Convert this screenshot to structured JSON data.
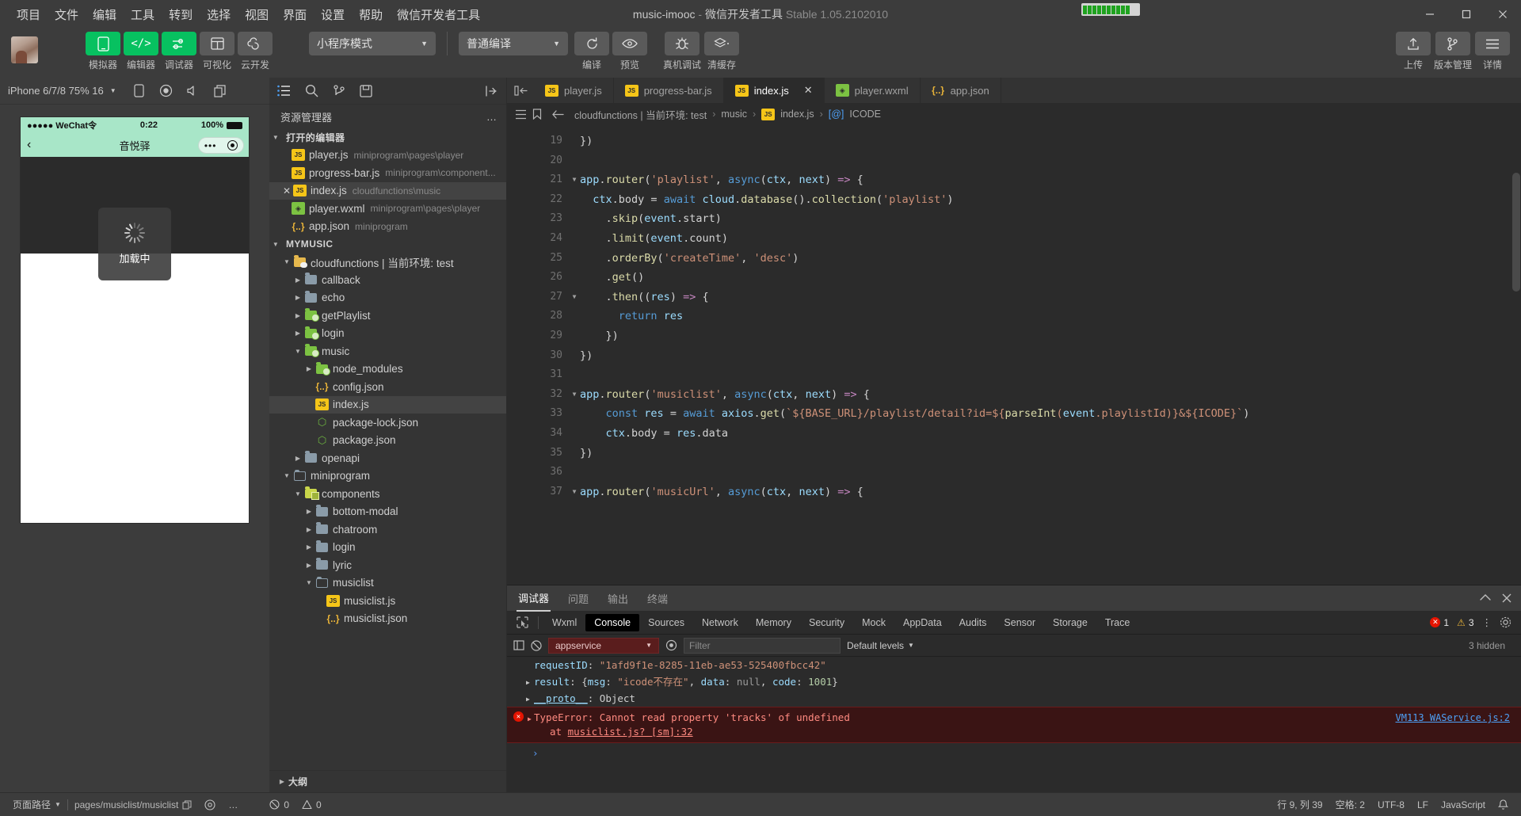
{
  "window": {
    "menu": [
      "项目",
      "文件",
      "编辑",
      "工具",
      "转到",
      "选择",
      "视图",
      "界面",
      "设置",
      "帮助",
      "微信开发者工具"
    ],
    "title_project": "music-imooc",
    "title_dash": " - ",
    "title_app": "微信开发者工具",
    "title_version": "Stable 1.05.2102010",
    "minimize": "—",
    "maximize": "▢",
    "close": "✕"
  },
  "toolbar": {
    "buttons": [
      {
        "label": "模拟器",
        "icon": "phone-icon",
        "style": "green"
      },
      {
        "label": "编辑器",
        "icon": "code-icon",
        "style": "green"
      },
      {
        "label": "调试器",
        "icon": "debug-toggle-icon",
        "style": "green"
      },
      {
        "label": "可视化",
        "icon": "layout-icon",
        "style": "grey"
      },
      {
        "label": "云开发",
        "icon": "cloud-icon",
        "style": "grey"
      }
    ],
    "mode_select": "小程序模式",
    "compile_select": "普通编译",
    "actions": [
      {
        "label": "编译",
        "icon": "refresh-icon"
      },
      {
        "label": "预览",
        "icon": "eye-icon"
      },
      {
        "label": "真机调试",
        "icon": "bug-icon"
      },
      {
        "label": "清缓存",
        "icon": "layers-icon"
      }
    ],
    "right_actions": [
      {
        "label": "上传",
        "icon": "upload-icon"
      },
      {
        "label": "版本管理",
        "icon": "git-branch-icon"
      },
      {
        "label": "详情",
        "icon": "menu-lines-icon"
      }
    ]
  },
  "simulator": {
    "device": "iPhone 6/7/8 75% 16",
    "icons": [
      "phone-rotate-icon",
      "record-icon",
      "volume-icon",
      "copy-icon"
    ],
    "phone": {
      "carrier": "●●●●● WeChat令",
      "time": "0:22",
      "battery_pct": "100%",
      "nav_title": "音悦驿",
      "back": "‹",
      "capsule_dots": "•••",
      "toast_text": "加载中"
    }
  },
  "explorer": {
    "icons": [
      "explorer-icon",
      "search-icon",
      "source-control-icon",
      "save-all-icon",
      "collapse-icon"
    ],
    "title": "资源管理器",
    "more": "…",
    "open_editors": {
      "label": "打开的编辑器",
      "items": [
        {
          "name": "player.js",
          "path": "miniprogram\\pages\\player",
          "icon": "js-file-icon",
          "indent": 2,
          "closable": false,
          "selected": false
        },
        {
          "name": "progress-bar.js",
          "path": "miniprogram\\component...",
          "icon": "js-file-icon",
          "indent": 2,
          "closable": false,
          "selected": false
        },
        {
          "name": "index.js",
          "path": "cloudfunctions\\music",
          "icon": "js-file-icon",
          "indent": 2,
          "closable": true,
          "selected": true
        },
        {
          "name": "player.wxml",
          "path": "miniprogram\\pages\\player",
          "icon": "wxml-file-icon",
          "indent": 2,
          "closable": false,
          "selected": false
        },
        {
          "name": "app.json",
          "path": "miniprogram",
          "icon": "json-file-icon",
          "indent": 2,
          "closable": false,
          "selected": false
        }
      ]
    },
    "project": {
      "label": "MYMUSIC",
      "items": [
        {
          "name": "cloudfunctions | 当前环境: test",
          "icon": "cloud-folder-icon",
          "indent": 1,
          "arrow": "down",
          "selected": false
        },
        {
          "name": "callback",
          "icon": "folder-icon",
          "indent": 2,
          "arrow": "right",
          "selected": false
        },
        {
          "name": "echo",
          "icon": "folder-icon",
          "indent": 2,
          "arrow": "right",
          "selected": false
        },
        {
          "name": "getPlaylist",
          "icon": "node-folder-icon",
          "indent": 2,
          "arrow": "right",
          "selected": false
        },
        {
          "name": "login",
          "icon": "node-folder-icon",
          "indent": 2,
          "arrow": "right",
          "selected": false
        },
        {
          "name": "music",
          "icon": "node-folder-icon",
          "indent": 2,
          "arrow": "down",
          "selected": false
        },
        {
          "name": "node_modules",
          "icon": "node-folder-icon",
          "indent": 3,
          "arrow": "right",
          "selected": false
        },
        {
          "name": "config.json",
          "icon": "json-file-icon",
          "indent": 3,
          "arrow": "none",
          "selected": false
        },
        {
          "name": "index.js",
          "icon": "js-file-icon",
          "indent": 3,
          "arrow": "none",
          "selected": true
        },
        {
          "name": "package-lock.json",
          "icon": "node-file-icon",
          "indent": 3,
          "arrow": "none",
          "selected": false
        },
        {
          "name": "package.json",
          "icon": "node-file-icon",
          "indent": 3,
          "arrow": "none",
          "selected": false
        },
        {
          "name": "openapi",
          "icon": "folder-icon",
          "indent": 2,
          "arrow": "right",
          "selected": false
        },
        {
          "name": "miniprogram",
          "icon": "folder-open-icon",
          "indent": 1,
          "arrow": "down",
          "selected": false
        },
        {
          "name": "components",
          "icon": "component-folder-icon",
          "indent": 2,
          "arrow": "down",
          "selected": false
        },
        {
          "name": "bottom-modal",
          "icon": "folder-icon",
          "indent": 3,
          "arrow": "right",
          "selected": false
        },
        {
          "name": "chatroom",
          "icon": "folder-icon",
          "indent": 3,
          "arrow": "right",
          "selected": false
        },
        {
          "name": "login",
          "icon": "folder-icon",
          "indent": 3,
          "arrow": "right",
          "selected": false
        },
        {
          "name": "lyric",
          "icon": "folder-icon",
          "indent": 3,
          "arrow": "right",
          "selected": false
        },
        {
          "name": "musiclist",
          "icon": "folder-open-icon",
          "indent": 3,
          "arrow": "down",
          "selected": false
        },
        {
          "name": "musiclist.js",
          "icon": "js-file-icon",
          "indent": 4,
          "arrow": "none",
          "selected": false
        },
        {
          "name": "musiclist.json",
          "icon": "json-file-icon",
          "indent": 4,
          "arrow": "none",
          "selected": false
        }
      ]
    },
    "outline": "大纲"
  },
  "editor": {
    "tabs": [
      {
        "label": "player.js",
        "icon": "js-file-icon",
        "active": false,
        "closable": false
      },
      {
        "label": "progress-bar.js",
        "icon": "js-file-icon",
        "active": false,
        "closable": false
      },
      {
        "label": "index.js",
        "icon": "js-file-icon",
        "active": true,
        "closable": true
      },
      {
        "label": "player.wxml",
        "icon": "wxml-file-icon",
        "active": false,
        "closable": false
      },
      {
        "label": "app.json",
        "icon": "json-file-icon",
        "active": false,
        "closable": false
      }
    ],
    "tab_close": "✕",
    "breadcrumb": [
      "cloudfunctions | 当前环境: test",
      "music",
      "index.js",
      "ICODE"
    ],
    "breadcrumb_sep": "›",
    "first_line": 19,
    "lines": [
      {
        "n": 19,
        "fold": "",
        "text": "})"
      },
      {
        "n": 20,
        "fold": "",
        "text": ""
      },
      {
        "n": 21,
        "fold": "down",
        "text": "app.router('playlist', async(ctx, next) => {"
      },
      {
        "n": 22,
        "fold": "",
        "text": "  ctx.body = await cloud.database().collection('playlist')"
      },
      {
        "n": 23,
        "fold": "",
        "text": "    .skip(event.start)"
      },
      {
        "n": 24,
        "fold": "",
        "text": "    .limit(event.count)"
      },
      {
        "n": 25,
        "fold": "",
        "text": "    .orderBy('createTime', 'desc')"
      },
      {
        "n": 26,
        "fold": "",
        "text": "    .get()"
      },
      {
        "n": 27,
        "fold": "down",
        "text": "    .then((res) => {"
      },
      {
        "n": 28,
        "fold": "",
        "text": "      return res"
      },
      {
        "n": 29,
        "fold": "",
        "text": "    })"
      },
      {
        "n": 30,
        "fold": "",
        "text": "})"
      },
      {
        "n": 31,
        "fold": "",
        "text": ""
      },
      {
        "n": 32,
        "fold": "down",
        "text": "app.router('musiclist', async(ctx, next) => {"
      },
      {
        "n": 33,
        "fold": "",
        "text": "    const res = await axios.get(`${BASE_URL}/playlist/detail?id=${parseInt(event.playlistId)}&${ICODE}`)"
      },
      {
        "n": 34,
        "fold": "",
        "text": "    ctx.body = res.data"
      },
      {
        "n": 35,
        "fold": "",
        "text": "})"
      },
      {
        "n": 36,
        "fold": "",
        "text": ""
      },
      {
        "n": 37,
        "fold": "down",
        "text": "app.router('musicUrl', async(ctx, next) => {"
      }
    ]
  },
  "debugger": {
    "panel_tabs": [
      "调试器",
      "问题",
      "输出",
      "终端"
    ],
    "panel_active": "调试器",
    "panel_actions": [
      "chevron-up-icon",
      "close-icon"
    ],
    "devtools_tabs": [
      "Wxml",
      "Console",
      "Sources",
      "Network",
      "Memory",
      "Security",
      "Mock",
      "AppData",
      "Audits",
      "Sensor",
      "Storage",
      "Trace"
    ],
    "devtools_active": "Console",
    "inspect_icon": "inspect-icon",
    "error_count": "1",
    "warning_count": "3",
    "more_icon": "⋮",
    "settings_icon": "gear-icon",
    "console": {
      "context": "appservice",
      "filter_placeholder": "Filter",
      "levels": "Default levels",
      "hidden": "3 hidden",
      "clear_icon": "clear-icon",
      "eye_icon": "eye-icon",
      "sidebar_icon": "sidebar-icon",
      "lines": [
        {
          "type": "kv",
          "key": "requestID",
          "value": "\"1afd9f1e-8285-11eb-ae53-525400fbcc42\""
        },
        {
          "type": "obj",
          "key": "result",
          "value": "{msg: \"icode不存在\", data: null, code: 1001}"
        },
        {
          "type": "obj",
          "key": "__proto__",
          "value": "Object"
        }
      ],
      "error": {
        "message": "TypeError: Cannot read property 'tracks' of undefined",
        "at": "at ",
        "source": "musiclist.js? [sm]:32",
        "right_source": "VM113 WAService.js:2"
      },
      "prompt": "›"
    }
  },
  "statusbar": {
    "page_path_label": "页面路径",
    "page_path": "pages/musiclist/musiclist",
    "copy_icon": "copy-icon",
    "eye_icon": "eye-icon",
    "more_icon": "…",
    "errors": "0",
    "warnings": "0",
    "cursor": "行 9, 列 39",
    "spaces": "空格: 2",
    "encoding": "UTF-8",
    "eol": "LF",
    "language": "JavaScript",
    "bell_icon": "bell-icon"
  },
  "colors": {
    "accent_green": "#07c160",
    "error_red": "#e51400",
    "warn_yellow": "#e8b339",
    "bg": "#3c3c3c",
    "editor_bg": "#2b2b2b"
  }
}
